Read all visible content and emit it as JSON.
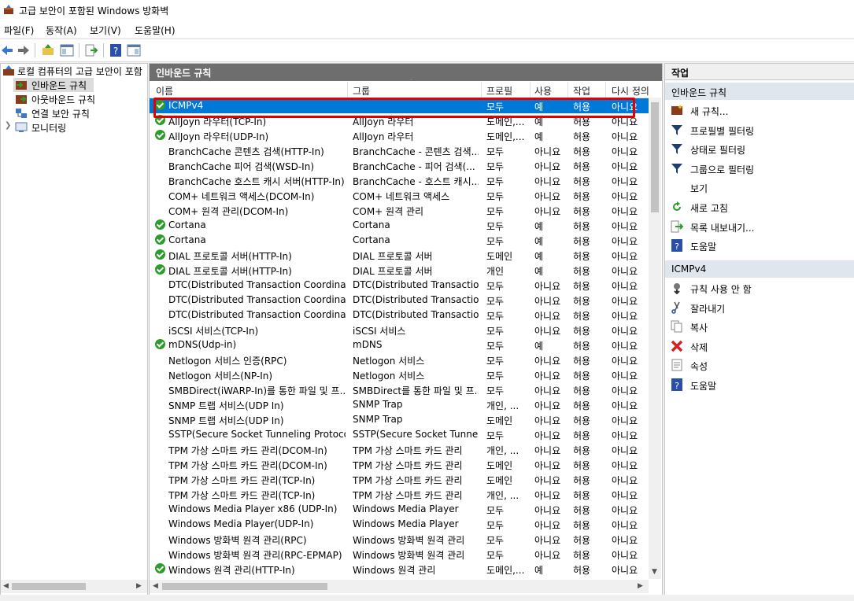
{
  "window": {
    "title": "고급 보안이 포함된 Windows 방화벽"
  },
  "menu": [
    "파일(F)",
    "동작(A)",
    "보기(V)",
    "도움말(H)"
  ],
  "tree": {
    "root": "로컬 컴퓨터의 고급 보안이 포함",
    "items": [
      "인바운드 규칙",
      "아웃바운드 규칙",
      "연결 보안 규칙",
      "모니터링"
    ]
  },
  "center": {
    "title": "인바운드 규칙",
    "columns": [
      "이름",
      "그룹",
      "프로필",
      "사용",
      "작업",
      "다시 정의"
    ],
    "rows": [
      {
        "en": true,
        "name": "ICMPv4",
        "group": "",
        "profile": "모두",
        "enabled": "예",
        "action": "허용",
        "override": "아니요"
      },
      {
        "en": true,
        "name": "AllJoyn 라우터(TCP-In)",
        "group": "AllJoyn 라우터",
        "profile": "도메인,...",
        "enabled": "예",
        "action": "허용",
        "override": "아니요"
      },
      {
        "en": true,
        "name": "AllJoyn 라우터(UDP-In)",
        "group": "AllJoyn 라우터",
        "profile": "도메인,...",
        "enabled": "예",
        "action": "허용",
        "override": "아니요"
      },
      {
        "en": false,
        "name": "BranchCache 콘텐츠 검색(HTTP-In)",
        "group": "BranchCache - 콘텐츠 검색...",
        "profile": "모두",
        "enabled": "아니요",
        "action": "허용",
        "override": "아니요"
      },
      {
        "en": false,
        "name": "BranchCache 피어 검색(WSD-In)",
        "group": "BranchCache - 피어 검색(...",
        "profile": "모두",
        "enabled": "아니요",
        "action": "허용",
        "override": "아니요"
      },
      {
        "en": false,
        "name": "BranchCache 호스트 캐시 서버(HTTP-In)",
        "group": "BranchCache - 호스트 캐시...",
        "profile": "모두",
        "enabled": "아니요",
        "action": "허용",
        "override": "아니요"
      },
      {
        "en": false,
        "name": "COM+ 네트워크 액세스(DCOM-In)",
        "group": "COM+ 네트워크 액세스",
        "profile": "모두",
        "enabled": "아니요",
        "action": "허용",
        "override": "아니요"
      },
      {
        "en": false,
        "name": "COM+ 원격 관리(DCOM-In)",
        "group": "COM+ 원격 관리",
        "profile": "모두",
        "enabled": "아니요",
        "action": "허용",
        "override": "아니요"
      },
      {
        "en": true,
        "name": "Cortana",
        "group": "Cortana",
        "profile": "모두",
        "enabled": "예",
        "action": "허용",
        "override": "아니요"
      },
      {
        "en": true,
        "name": "Cortana",
        "group": "Cortana",
        "profile": "모두",
        "enabled": "예",
        "action": "허용",
        "override": "아니요"
      },
      {
        "en": true,
        "name": "DIAL 프로토콜 서버(HTTP-In)",
        "group": "DIAL 프로토콜 서버",
        "profile": "도메인",
        "enabled": "예",
        "action": "허용",
        "override": "아니요"
      },
      {
        "en": true,
        "name": "DIAL 프로토콜 서버(HTTP-In)",
        "group": "DIAL 프로토콜 서버",
        "profile": "개인",
        "enabled": "예",
        "action": "허용",
        "override": "아니요"
      },
      {
        "en": false,
        "name": "DTC(Distributed Transaction Coordinato...",
        "group": "DTC(Distributed Transactio...",
        "profile": "모두",
        "enabled": "아니요",
        "action": "허용",
        "override": "아니요"
      },
      {
        "en": false,
        "name": "DTC(Distributed Transaction Coordinato...",
        "group": "DTC(Distributed Transactio...",
        "profile": "모두",
        "enabled": "아니요",
        "action": "허용",
        "override": "아니요"
      },
      {
        "en": false,
        "name": "DTC(Distributed Transaction Coordinato...",
        "group": "DTC(Distributed Transactio...",
        "profile": "모두",
        "enabled": "아니요",
        "action": "허용",
        "override": "아니요"
      },
      {
        "en": false,
        "name": "iSCSI 서비스(TCP-In)",
        "group": "iSCSI 서비스",
        "profile": "모두",
        "enabled": "아니요",
        "action": "허용",
        "override": "아니요"
      },
      {
        "en": true,
        "name": "mDNS(Udp-in)",
        "group": "mDNS",
        "profile": "모두",
        "enabled": "예",
        "action": "허용",
        "override": "아니요"
      },
      {
        "en": false,
        "name": "Netlogon 서비스 인증(RPC)",
        "group": "Netlogon 서비스",
        "profile": "모두",
        "enabled": "아니요",
        "action": "허용",
        "override": "아니요"
      },
      {
        "en": false,
        "name": "Netlogon 서비스(NP-In)",
        "group": "Netlogon 서비스",
        "profile": "모두",
        "enabled": "아니요",
        "action": "허용",
        "override": "아니요"
      },
      {
        "en": false,
        "name": "SMBDirect(iWARP-In)를 통한 파일 및 프...",
        "group": "SMBDirect를 통한 파일 및 프...",
        "profile": "모두",
        "enabled": "아니요",
        "action": "허용",
        "override": "아니요"
      },
      {
        "en": false,
        "name": "SNMP 트랩 서비스(UDP In)",
        "group": "SNMP Trap",
        "profile": "개인, ...",
        "enabled": "아니요",
        "action": "허용",
        "override": "아니요"
      },
      {
        "en": false,
        "name": "SNMP 트랩 서비스(UDP In)",
        "group": "SNMP Trap",
        "profile": "도메인",
        "enabled": "아니요",
        "action": "허용",
        "override": "아니요"
      },
      {
        "en": false,
        "name": "SSTP(Secure Socket Tunneling Protocol)...",
        "group": "SSTP(Secure Socket Tunnel...",
        "profile": "모두",
        "enabled": "아니요",
        "action": "허용",
        "override": "아니요"
      },
      {
        "en": false,
        "name": "TPM 가상 스마트 카드 관리(DCOM-In)",
        "group": "TPM 가상 스마트 카드 관리",
        "profile": "개인, ...",
        "enabled": "아니요",
        "action": "허용",
        "override": "아니요"
      },
      {
        "en": false,
        "name": "TPM 가상 스마트 카드 관리(DCOM-In)",
        "group": "TPM 가상 스마트 카드 관리",
        "profile": "도메인",
        "enabled": "아니요",
        "action": "허용",
        "override": "아니요"
      },
      {
        "en": false,
        "name": "TPM 가상 스마트 카드 관리(TCP-In)",
        "group": "TPM 가상 스마트 카드 관리",
        "profile": "도메인",
        "enabled": "아니요",
        "action": "허용",
        "override": "아니요"
      },
      {
        "en": false,
        "name": "TPM 가상 스마트 카드 관리(TCP-In)",
        "group": "TPM 가상 스마트 카드 관리",
        "profile": "개인, ...",
        "enabled": "아니요",
        "action": "허용",
        "override": "아니요"
      },
      {
        "en": false,
        "name": "Windows Media Player x86 (UDP-In)",
        "group": "Windows Media Player",
        "profile": "모두",
        "enabled": "아니요",
        "action": "허용",
        "override": "아니요"
      },
      {
        "en": false,
        "name": "Windows Media Player(UDP-In)",
        "group": "Windows Media Player",
        "profile": "모두",
        "enabled": "아니요",
        "action": "허용",
        "override": "아니요"
      },
      {
        "en": false,
        "name": "Windows 방화벽 원격 관리(RPC)",
        "group": "Windows 방화벽 원격 관리",
        "profile": "모두",
        "enabled": "아니요",
        "action": "허용",
        "override": "아니요"
      },
      {
        "en": false,
        "name": "Windows 방화벽 원격 관리(RPC-EPMAP)",
        "group": "Windows 방화벽 원격 관리",
        "profile": "모두",
        "enabled": "아니요",
        "action": "허용",
        "override": "아니요"
      },
      {
        "en": true,
        "name": "Windows 원격 관리(HTTP-In)",
        "group": "Windows 원격 관리",
        "profile": "도메인,...",
        "enabled": "예",
        "action": "허용",
        "override": "아니요"
      }
    ]
  },
  "actions": {
    "title": "작업",
    "section1": "인바운드 규칙",
    "items1": [
      {
        "label": "새 규칙...",
        "icon": "new-rule-icon"
      },
      {
        "label": "프로필별 필터링",
        "icon": "filter-icon"
      },
      {
        "label": "상태로 필터링",
        "icon": "filter-icon"
      },
      {
        "label": "그룹으로 필터링",
        "icon": "filter-icon"
      },
      {
        "label": "보기",
        "icon": ""
      },
      {
        "label": "새로 고침",
        "icon": "refresh-icon"
      },
      {
        "label": "목록 내보내기...",
        "icon": "export-icon"
      },
      {
        "label": "도움말",
        "icon": "help-icon"
      }
    ],
    "section2": "ICMPv4",
    "items2": [
      {
        "label": "규칙 사용 안 함",
        "icon": "disable-icon"
      },
      {
        "label": "잘라내기",
        "icon": "cut-icon"
      },
      {
        "label": "복사",
        "icon": "copy-icon"
      },
      {
        "label": "삭제",
        "icon": "delete-icon"
      },
      {
        "label": "속성",
        "icon": "properties-icon"
      },
      {
        "label": "도움말",
        "icon": "help-icon"
      }
    ]
  }
}
